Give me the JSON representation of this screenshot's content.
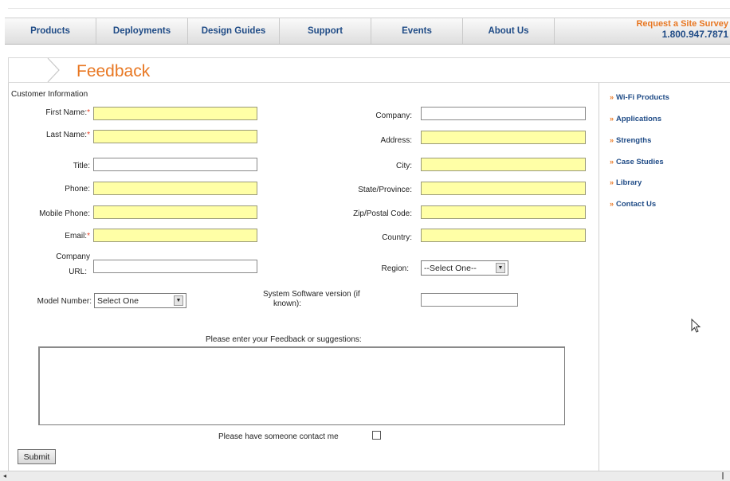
{
  "nav": {
    "items": [
      "Products",
      "Deployments",
      "Design Guides",
      "Support",
      "Events",
      "About Us"
    ],
    "survey_line1": "Request a Site Survey",
    "survey_line2": "1.800.947.7871",
    "accent": "#e87722",
    "link_color": "#1f4b86"
  },
  "page": {
    "title": "Feedback"
  },
  "form": {
    "section_label": "Customer Information",
    "required_mark": "*",
    "left_fields": {
      "first_name": "First Name:",
      "last_name": "Last Name:",
      "title": "Title:",
      "phone": "Phone:",
      "mobile": "Mobile Phone:",
      "email": "Email:",
      "company_url_1": "Company",
      "company_url_2": "URL:"
    },
    "right_fields": {
      "company": "Company:",
      "address": "Address:",
      "city": "City:",
      "state": "State/Province:",
      "zip": "Zip/Postal Code:",
      "country": "Country:",
      "region": "Region:"
    },
    "region_select": "--Select One--",
    "model_label": "Model Number:",
    "model_select": "Select One",
    "software_label_1": "System Software version (if",
    "software_label_2": "known):",
    "feedback_label": "Please enter your Feedback or suggestions:",
    "contact_label": "Please have someone contact me",
    "submit_label": "Submit",
    "required_fill": "#ffffa6"
  },
  "sidebar": {
    "arrow": "»",
    "items": [
      "Wi-Fi Products",
      "Applications",
      "Strengths",
      "Case Studies",
      "Library",
      "Contact Us"
    ]
  },
  "icons": [
    "chevron-right-icon",
    "dropdown-arrow-icon",
    "checkbox-icon",
    "mouse-cursor-icon",
    "scroll-left-arrow-icon"
  ]
}
